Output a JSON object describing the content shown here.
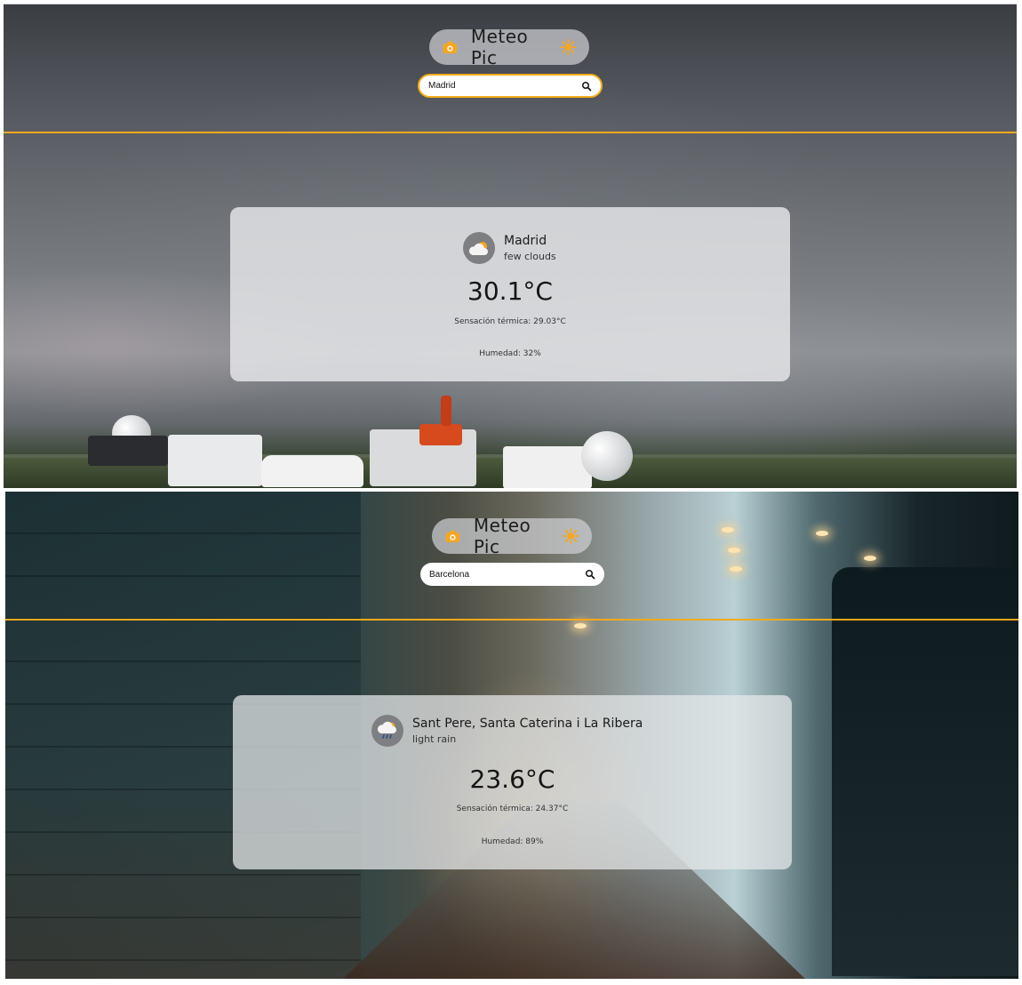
{
  "colors": {
    "accent": "#f4a91c",
    "icon_orange": "#f5a623",
    "card_bg": "#e6e8ea"
  },
  "views": [
    {
      "app_title": "Meteo Pic",
      "search": {
        "value": "Madrid",
        "focused": true
      },
      "weather": {
        "city": "Madrid",
        "description": "few clouds",
        "icon": "cloud-sun-icon",
        "temperature": "30.1°C",
        "feels_like": "Sensación térmica: 29.03°C",
        "humidity": "Humedad: 32%"
      }
    },
    {
      "app_title": "Meteo Pic",
      "search": {
        "value": "Barcelona",
        "focused": false
      },
      "weather": {
        "city": "Sant Pere, Santa Caterina i La Ribera",
        "description": "light rain",
        "icon": "cloud-rain-icon",
        "temperature": "23.6°C",
        "feels_like": "Sensación térmica: 24.37°C",
        "humidity": "Humedad: 89%"
      }
    }
  ]
}
